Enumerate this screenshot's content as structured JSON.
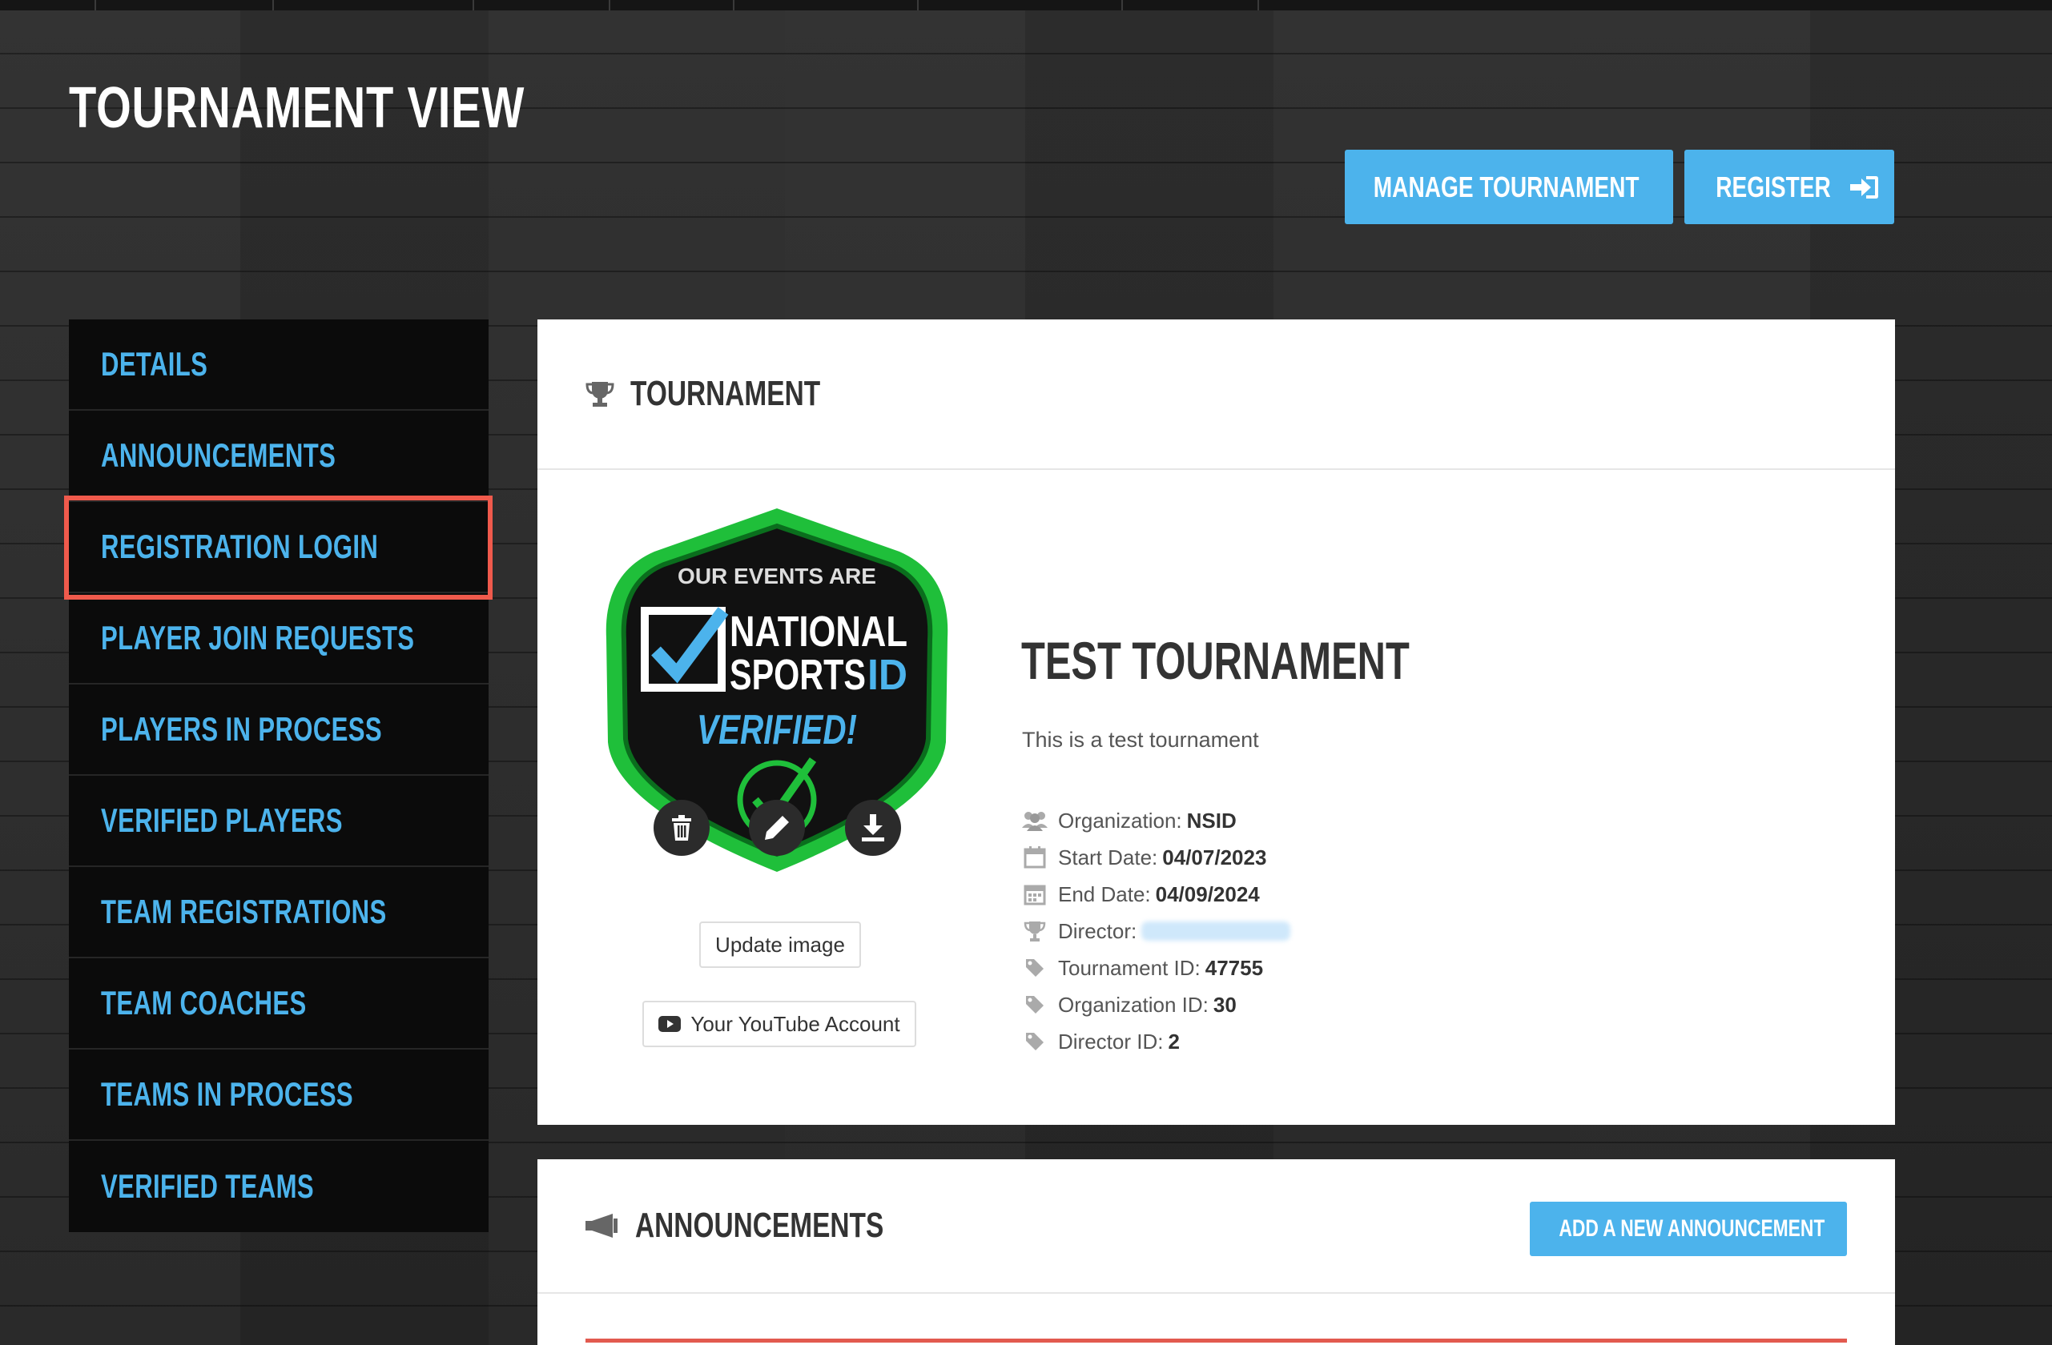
{
  "page": {
    "title": "TOURNAMENT VIEW"
  },
  "header": {
    "manage_label": "MANAGE TOURNAMENT",
    "register_label": "REGISTER"
  },
  "sidebar": {
    "items": [
      {
        "label": "DETAILS"
      },
      {
        "label": "ANNOUNCEMENTS"
      },
      {
        "label": "REGISTRATION LOGIN",
        "highlighted": true
      },
      {
        "label": "PLAYER JOIN REQUESTS"
      },
      {
        "label": "PLAYERS IN PROCESS"
      },
      {
        "label": "VERIFIED PLAYERS"
      },
      {
        "label": "TEAM REGISTRATIONS"
      },
      {
        "label": "TEAM COACHES"
      },
      {
        "label": "TEAMS IN PROCESS"
      },
      {
        "label": "VERIFIED TEAMS"
      }
    ]
  },
  "tournament_card": {
    "heading": "TOURNAMENT",
    "badge": {
      "line1": "OUR EVENTS ARE",
      "line2": "NATIONAL",
      "line3a": "SPORTS",
      "line3b": "ID",
      "line4": "VERIFIED!"
    },
    "update_image_label": "Update image",
    "youtube_label": "Your YouTube Account",
    "name": "TEST TOURNAMENT",
    "description": "This is a test tournament",
    "info": {
      "organization_label": "Organization:",
      "organization_value": "NSID",
      "start_label": "Start Date:",
      "start_value": "04/07/2023",
      "end_label": "End Date:",
      "end_value": "04/09/2024",
      "director_label": "Director:",
      "tid_label": "Tournament ID:",
      "tid_value": "47755",
      "oid_label": "Organization ID:",
      "oid_value": "30",
      "did_label": "Director ID:",
      "did_value": "2"
    }
  },
  "announcements_card": {
    "heading": "ANNOUNCEMENTS",
    "add_label": "ADD A NEW ANNOUNCEMENT"
  },
  "colors": {
    "accent": "#4cb3ec",
    "highlight": "#f05a4c",
    "badge_green": "#1fbf3a"
  },
  "icons": [
    "caret-down-icon",
    "sign-in-icon",
    "trophy-icon",
    "trash-icon",
    "pencil-icon",
    "download-icon",
    "youtube-icon",
    "users-icon",
    "calendar-icon",
    "tag-icon",
    "megaphone-icon",
    "plus-icon"
  ]
}
